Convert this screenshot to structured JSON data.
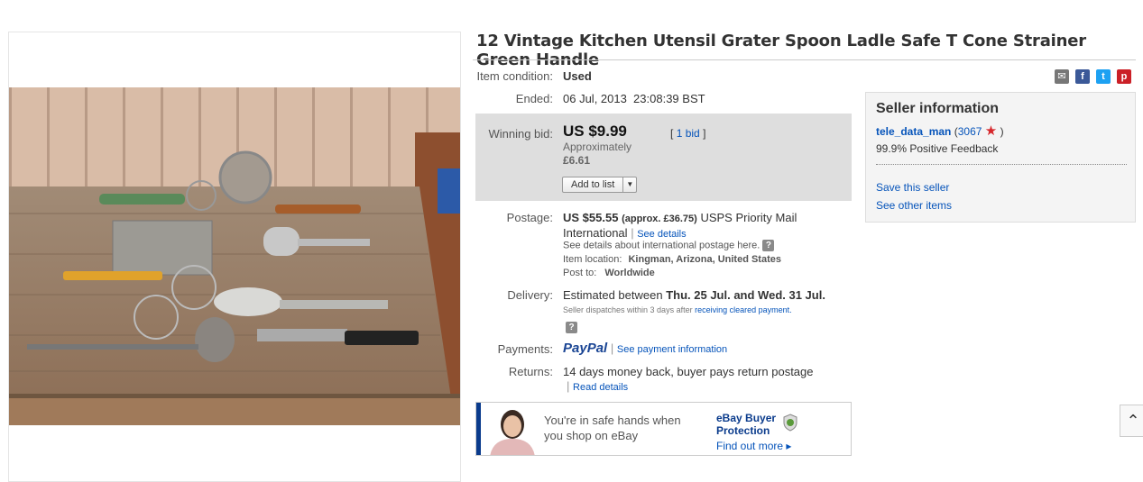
{
  "title": "12 Vintage Kitchen Utensil Grater Spoon Ladle Safe T Cone Strainer Green Handle",
  "condition": {
    "label": "Item condition:",
    "value": "Used"
  },
  "ended": {
    "label": "Ended:",
    "value": "06 Jul, 2013  23:08:39 BST"
  },
  "bid": {
    "label": "Winning bid:",
    "price": "US $9.99",
    "approx_label": "Approximately",
    "approx_value": "£6.61",
    "bids_open": "[",
    "bids_link": "1 bid",
    "bids_close": "]",
    "add_to_list": "Add to list"
  },
  "postage": {
    "label": "Postage:",
    "amount": "US $55.55",
    "approx": "(approx. £36.75)",
    "service": "USPS Priority Mail",
    "service2": "International",
    "see_details": "See details",
    "intl_note": "See details about international postage here.",
    "location_label": "Item location:",
    "location": "Kingman, Arizona, United States",
    "post_to_label": "Post to:",
    "post_to": "Worldwide"
  },
  "delivery": {
    "label": "Delivery:",
    "estimated": "Estimated between",
    "dates": "Thu. 25 Jul. and Wed. 31 Jul.",
    "dispatch_note": "Seller dispatches within 3 days after",
    "dispatch_link": "receiving cleared payment."
  },
  "payments": {
    "label": "Payments:",
    "paypal": "PayPal",
    "see_link": "See payment information"
  },
  "returns": {
    "label": "Returns:",
    "value": "14 days money back, buyer pays return postage",
    "read": "Read details"
  },
  "seller": {
    "heading": "Seller information",
    "name": "tele_data_man",
    "score_open": "(",
    "score": "3067",
    "score_close": ")",
    "feedback": "99.9% Positive Feedback",
    "save": "Save this seller",
    "other": "See other items"
  },
  "protection": {
    "line1": "You're in safe hands when",
    "line2": "you shop on eBay",
    "brand1": "eBay Buyer",
    "brand2": "Protection",
    "find": "Find out more ▸"
  },
  "icons": {
    "email": "email-icon",
    "facebook": "facebook-icon",
    "twitter": "twitter-icon",
    "pinterest": "pinterest-icon",
    "star": "star-icon",
    "scroll_up": "chevron-up-icon",
    "help": "help-icon",
    "shield": "shield-icon"
  },
  "colors": {
    "link": "#0654ba",
    "bidbox": "#dedede",
    "star": "#d6262b",
    "paypal": "#1a4594"
  }
}
